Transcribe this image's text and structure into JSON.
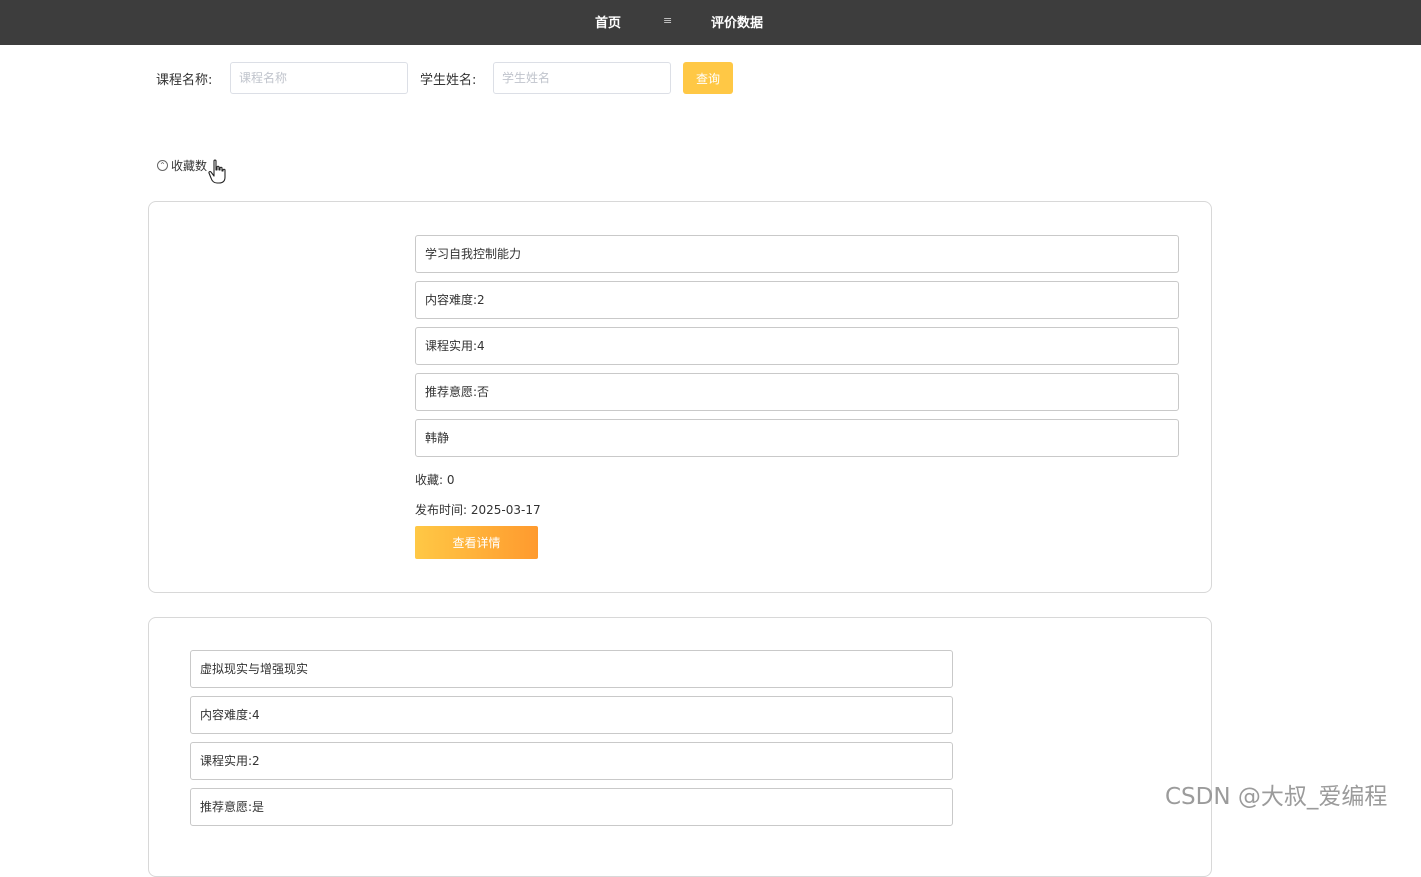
{
  "nav": {
    "home": "首页",
    "separator": "≡",
    "evaluation": "评价数据"
  },
  "search": {
    "course_label": "课程名称:",
    "course_placeholder": "课程名称",
    "student_label": "学生姓名:",
    "student_placeholder": "学生姓名",
    "query_label": "查询"
  },
  "sort": {
    "label": "收藏数"
  },
  "cards": [
    {
      "title": "学习自我控制能力",
      "difficulty": "内容难度:2",
      "practicality": "课程实用:4",
      "recommend": "推荐意愿:否",
      "student": "韩静",
      "favorites": "收藏: 0",
      "published": "发布时间: 2025-03-17",
      "detail_label": "查看详情"
    },
    {
      "title": "虚拟现实与增强现实",
      "difficulty": "内容难度:4",
      "practicality": "课程实用:2",
      "recommend": "推荐意愿:是"
    }
  ],
  "watermark": "CSDN @大叔_爱编程",
  "colors": {
    "topbar": "#3d3d3d",
    "accent": "#ffc845",
    "accent_end": "#ff9a2e"
  }
}
